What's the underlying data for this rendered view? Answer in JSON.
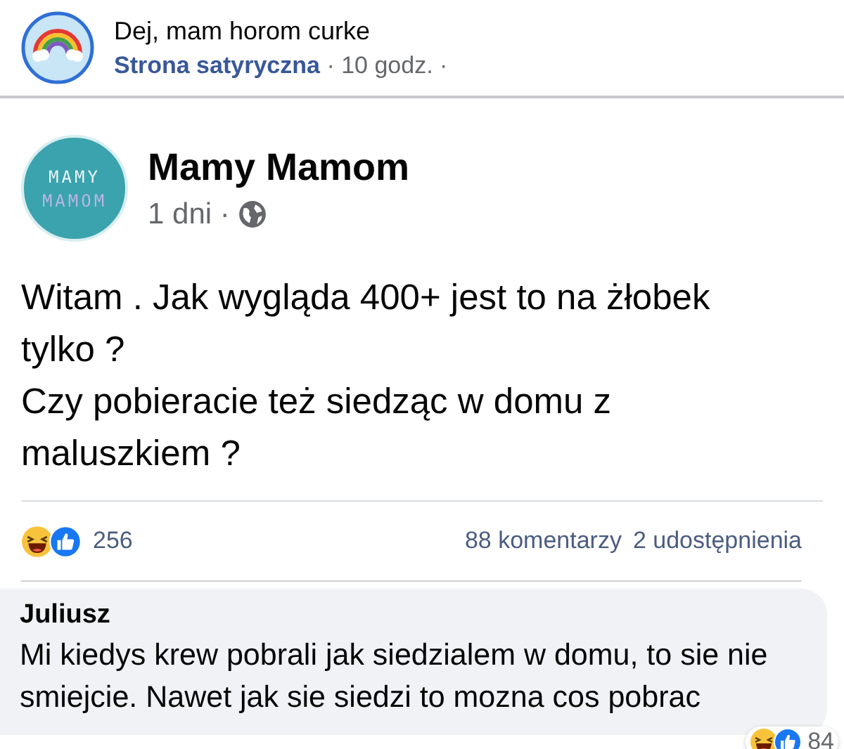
{
  "shared_by": {
    "title": "Dej, mam horom curke",
    "page": "Strona satyryczna",
    "meta": "· 10 godz. ·"
  },
  "post": {
    "author": "Mamy Mamom",
    "avatar_logo": [
      "MAMY",
      "MAMOM"
    ],
    "time": "1 dni ·",
    "paragraphs": [
      "Witam . Jak wygląda 400+ jest to na żłobek tylko ?",
      "Czy pobieracie też siedząc w domu z maluszkiem ?"
    ]
  },
  "reactions": {
    "count": "256",
    "comments": "88 komentarzy",
    "shares": "2 udostępnienia"
  },
  "comment": {
    "author": "Juliusz",
    "text": "Mi kiedys krew pobrali jak siedzialem w domu, to sie nie smiejcie. Nawet jak sie siedzi to mozna cos pobrac",
    "reaction_count": "84"
  }
}
